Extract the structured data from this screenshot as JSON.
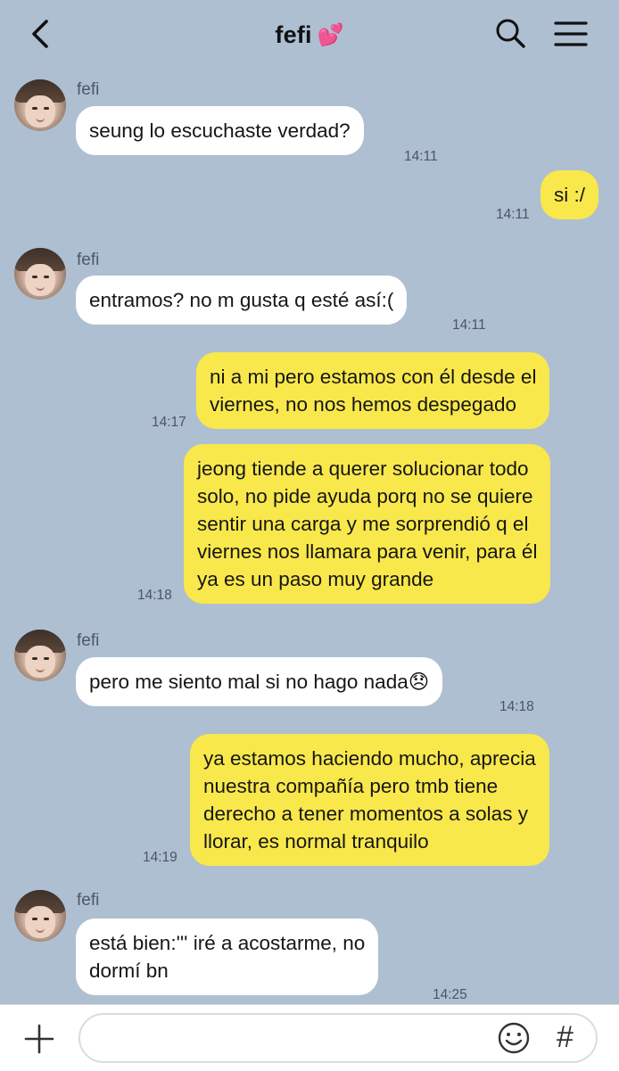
{
  "header": {
    "title": "fefi",
    "title_emoji": "💕",
    "icons": [
      "chevron-left-icon",
      "search-icon",
      "menu-icon"
    ]
  },
  "messages": [
    {
      "sender": "fefi",
      "direction": "in",
      "text": "seung lo escuchaste verdad?",
      "time": "14:11"
    },
    {
      "direction": "out",
      "text": "si :/",
      "time": "14:11"
    },
    {
      "sender": "fefi",
      "direction": "in",
      "text": "entramos? no m gusta q esté así:(",
      "time": "14:11"
    },
    {
      "direction": "out",
      "text": "ni a mi pero estamos con él desde el\nviernes, no nos hemos despegado",
      "time": "14:17"
    },
    {
      "direction": "out",
      "text": "jeong tiende a querer solucionar todo\nsolo, no pide ayuda porq no se quiere\nsentir una carga y me sorprendió q el\nviernes nos llamara para venir, para él\nya es un paso muy grande",
      "time": "14:18"
    },
    {
      "sender": "fefi",
      "direction": "in",
      "text": "pero me siento mal si no hago nada😞",
      "time": "14:18"
    },
    {
      "direction": "out",
      "text": "ya estamos haciendo mucho, aprecia\nnuestra compañía pero tmb tiene\nderecho a tener momentos a solas y\nllorar, es normal tranquilo",
      "time": "14:19"
    },
    {
      "sender": "fefi",
      "direction": "in",
      "text": "está bien:''' iré a acostarme, no\ndormí bn",
      "time": "14:25"
    }
  ],
  "footer": {
    "input_value": "",
    "input_placeholder": "",
    "hash_label": "#",
    "icons": [
      "plus-icon",
      "emoji-icon",
      "hashtag-icon"
    ]
  },
  "colors": {
    "background": "#aebfd2",
    "incoming_bubble": "#ffffff",
    "outgoing_bubble": "#f9e84b",
    "footer": "#ffffff"
  }
}
